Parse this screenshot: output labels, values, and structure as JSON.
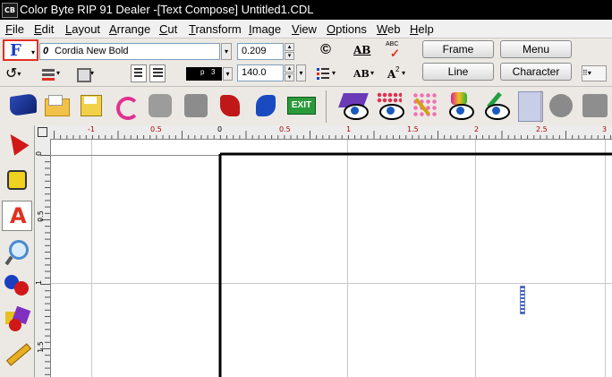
{
  "window": {
    "app_icon_text": "CB",
    "title": "Color Byte RIP 91 Dealer -[Text Compose] Untitled1.CDL"
  },
  "menu": [
    "File",
    "Edit",
    "Layout",
    "Arrange",
    "Cut",
    "Transform",
    "Image",
    "View",
    "Options",
    "Web",
    "Help"
  ],
  "menu_underline": [
    "F",
    "E",
    "L",
    "A",
    "C",
    "T",
    "I",
    "V",
    "O",
    "W",
    "H"
  ],
  "toolbar": {
    "font_button_label": "F",
    "font_prefix": "0",
    "font_name": "Cordia New Bold",
    "size_value": "0.209",
    "spacing_value": "140.0",
    "copyright_symbol": "©",
    "spell_label": "ABC",
    "ab_label": "AB",
    "ab_small_label": "AB",
    "superscript_label": "A",
    "superscript_mark": "2",
    "color_field_value": "p",
    "color_field_value2": "3",
    "frame_button": "Frame",
    "menu_button": "Menu",
    "line_button": "Line",
    "character_button": "Character"
  },
  "toolbar_icons": [
    "undo-icon",
    "align-icon",
    "print-icon",
    "justify-left-icon",
    "justify-center-icon",
    "list-icon"
  ],
  "bigbar_icons": [
    "shape-blue-icon",
    "open-folder-icon",
    "save-disk-icon",
    "arrow-rotate-icon",
    "gear-gray-icon",
    "puzzle-gray-icon",
    "red-shape-icon",
    "blue-shape-icon",
    "exit-sign-icon",
    "eye-purple-icon",
    "eye-dots-icon",
    "magic-wand-icon",
    "eye-rainbow-icon",
    "eye-pencil-icon",
    "blank-icon",
    "grid-gray-icon",
    "blocks-gray-icon"
  ],
  "exit_text": "EXIT",
  "left_tools": [
    "pointer-tool-icon",
    "measure-tool-icon",
    "text-tool-icon",
    "magnify-tool-icon",
    "fill-tool-icon",
    "shapes-tool-icon",
    "pencil-tool-icon"
  ],
  "text_tool_letter": "A",
  "ruler": {
    "h_labels": [
      "-1",
      "0.5",
      "0",
      "0.5",
      "1",
      "1.5",
      "2",
      "2.5",
      "3"
    ],
    "v_labels": [
      "0",
      "0.5",
      "1",
      "1.5"
    ]
  },
  "colors": {
    "title_bg": "#000000",
    "accent_red": "#e03020",
    "ruler_label": "#b00000",
    "guide": "#c8c8c8"
  }
}
